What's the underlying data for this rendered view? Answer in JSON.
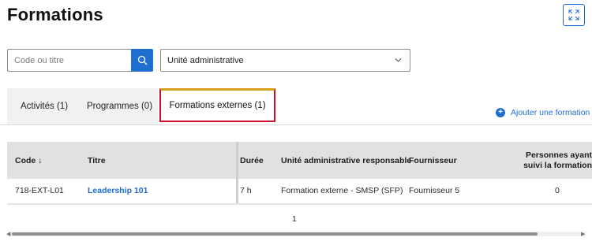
{
  "page": {
    "title": "Formations"
  },
  "icons": {
    "expand": "expand-icon",
    "search": "search-icon",
    "chevron": "chevron-down-icon",
    "add": "plus-circle-icon",
    "sort": "arrow-down-icon"
  },
  "colors": {
    "primary": "#1f6fd1",
    "active_tab_border": "#c8102e",
    "active_tab_top": "#d7a21b",
    "header_bg": "#e1e1e1"
  },
  "filters": {
    "search_placeholder": "Code ou titre",
    "unit_select_value": "Unité administrative"
  },
  "tabs": [
    {
      "label": "Activités (1)"
    },
    {
      "label": "Programmes (0)"
    },
    {
      "label": "Formations externes (1)"
    }
  ],
  "actions": {
    "add_label": "Ajouter une formation"
  },
  "table": {
    "columns": [
      {
        "label": "Code ↓"
      },
      {
        "label": "Titre"
      },
      {
        "label": "Durée"
      },
      {
        "label": "Unité administrative responsable"
      },
      {
        "label": "Fournisseur"
      },
      {
        "label": "Personnes ayant suivi la formation"
      }
    ],
    "rows": [
      {
        "code": "718-EXT-L01",
        "title": "Leadership 101",
        "duration": "7 h",
        "unit": "Formation externe - SMSP (SFP)",
        "provider": "Fournisseur 5",
        "count": "0"
      }
    ]
  },
  "pagination": {
    "current_page": "1"
  }
}
